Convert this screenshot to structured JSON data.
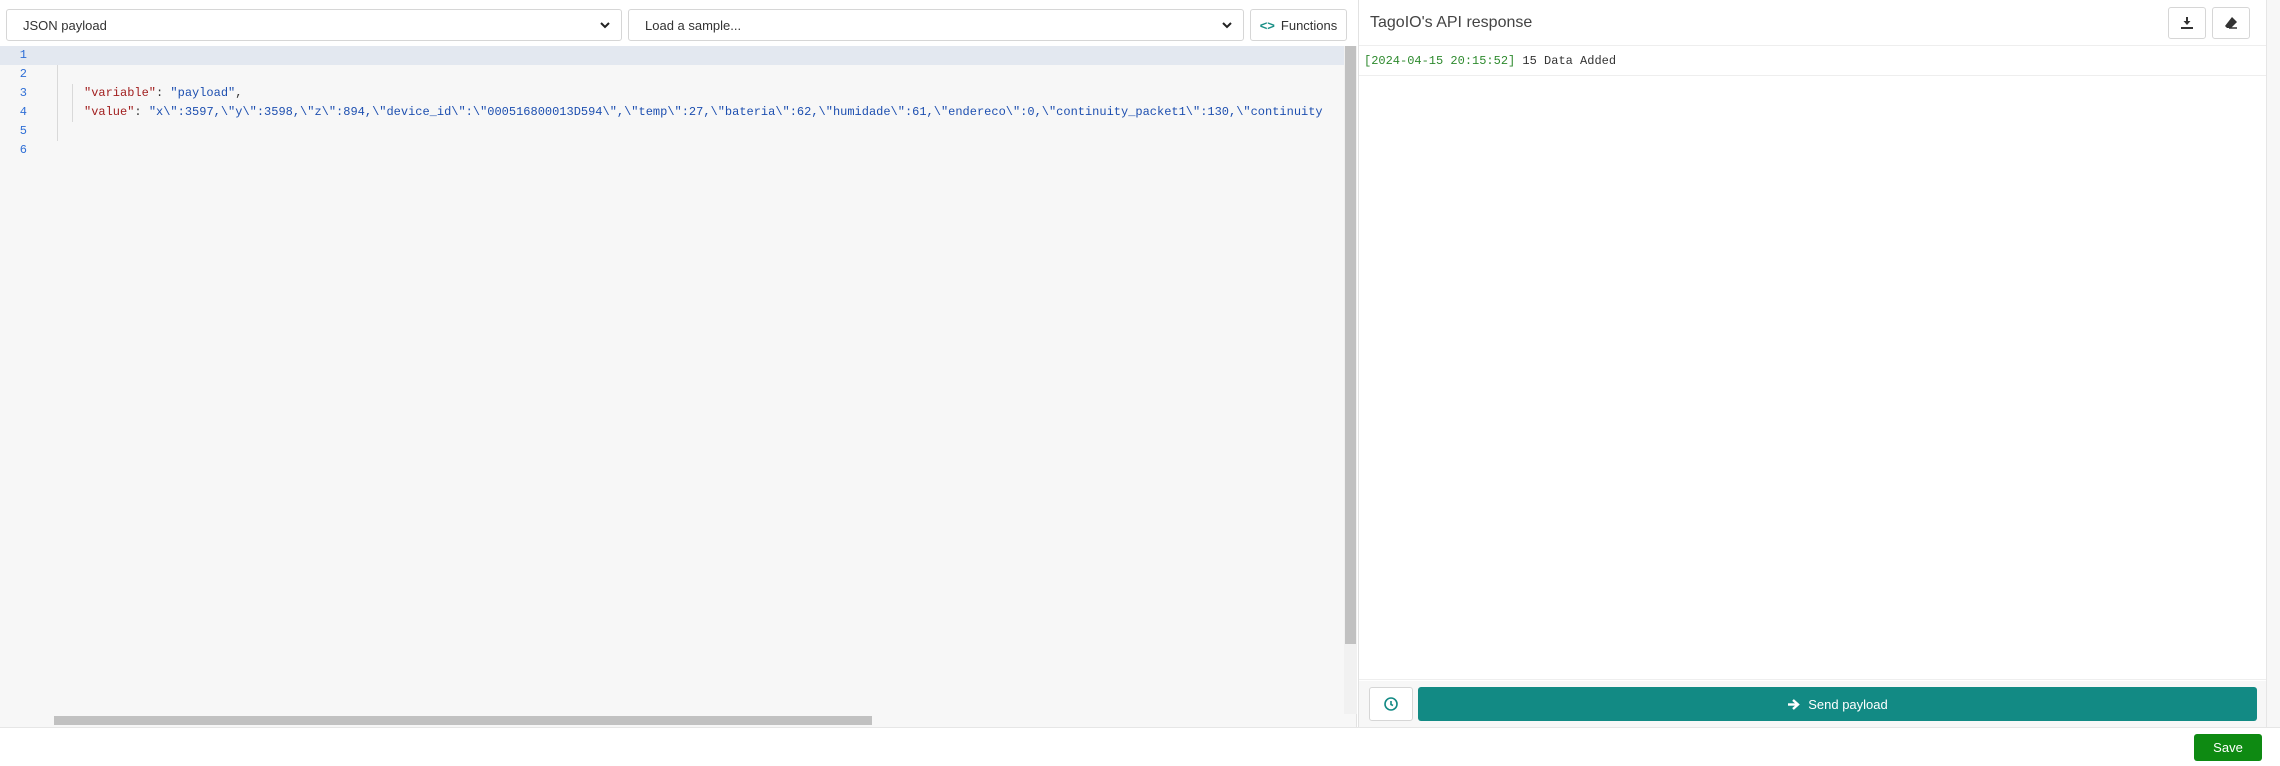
{
  "toolbar": {
    "mode_select": "JSON payload",
    "sample_select": "Load a sample...",
    "functions_label": "Functions"
  },
  "editor": {
    "line_numbers": [
      "1",
      "2",
      "3",
      "4",
      "5",
      "6"
    ],
    "lines": {
      "l1": "[",
      "l2": "{",
      "l3_key": "\"variable\"",
      "l3_sep": ": ",
      "l3_val": "\"payload\"",
      "l3_end": ",",
      "l4_key": "\"value\"",
      "l4_sep": ": ",
      "l4_val": "\"x\\\":3597,\\\"y\\\":3598,\\\"z\\\":894,\\\"device_id\\\":\\\"000516800013D594\\\",\\\"temp\\\":27,\\\"bateria\\\":62,\\\"humidade\\\":61,\\\"endereco\\\":0,\\\"continuity_packet1\\\":130,\\\"continuity",
      "l5": "}",
      "l6": "]"
    }
  },
  "response": {
    "title": "TagoIO's API response",
    "log_timestamp": "[2024-04-15 20:15:52]",
    "log_message": " 15 Data Added",
    "send_label": "Send payload"
  },
  "footer": {
    "save_label": "Save"
  },
  "colors": {
    "send_button": "#128a84",
    "save_button": "#0e8a12",
    "line_number": "#2f6fd6",
    "json_key": "#a11e1e",
    "json_string": "#1d4fb0",
    "log_timestamp": "#2e8a2e"
  },
  "icons": {
    "functions": "code-brackets-icon",
    "download": "download-icon",
    "eraser": "eraser-icon",
    "history": "history-clock-icon",
    "send": "arrow-right-icon",
    "select_chevron": "chevron-down-icon"
  }
}
